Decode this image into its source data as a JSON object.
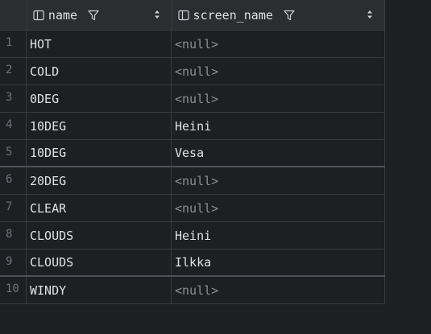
{
  "columns": [
    {
      "label": "name"
    },
    {
      "label": "screen_name"
    }
  ],
  "rows": [
    {
      "num": "1",
      "name": "HOT",
      "screen_name": "<null>",
      "null": true
    },
    {
      "num": "2",
      "name": "COLD",
      "screen_name": "<null>",
      "null": true
    },
    {
      "num": "3",
      "name": "0DEG",
      "screen_name": "<null>",
      "null": true
    },
    {
      "num": "4",
      "name": "10DEG",
      "screen_name": "Heini",
      "null": false
    },
    {
      "num": "5",
      "name": "10DEG",
      "screen_name": "Vesa",
      "null": false
    },
    {
      "num": "6",
      "name": "20DEG",
      "screen_name": "<null>",
      "null": true
    },
    {
      "num": "7",
      "name": "CLEAR",
      "screen_name": "<null>",
      "null": true
    },
    {
      "num": "8",
      "name": "CLOUDS",
      "screen_name": "Heini",
      "null": false
    },
    {
      "num": "9",
      "name": "CLOUDS",
      "screen_name": "Ilkka",
      "null": false
    },
    {
      "num": "10",
      "name": "WINDY",
      "screen_name": "<null>",
      "null": true
    }
  ],
  "icons": {
    "column": "column-icon",
    "filter": "filter-icon",
    "sort": "sort-icon"
  },
  "colors": {
    "background": "#1e1f22",
    "header": "#2b2d30",
    "text": "#dfe1e5",
    "null_text": "#8c8f94",
    "row_number": "#6f737a",
    "grid_line": "#393b40"
  }
}
